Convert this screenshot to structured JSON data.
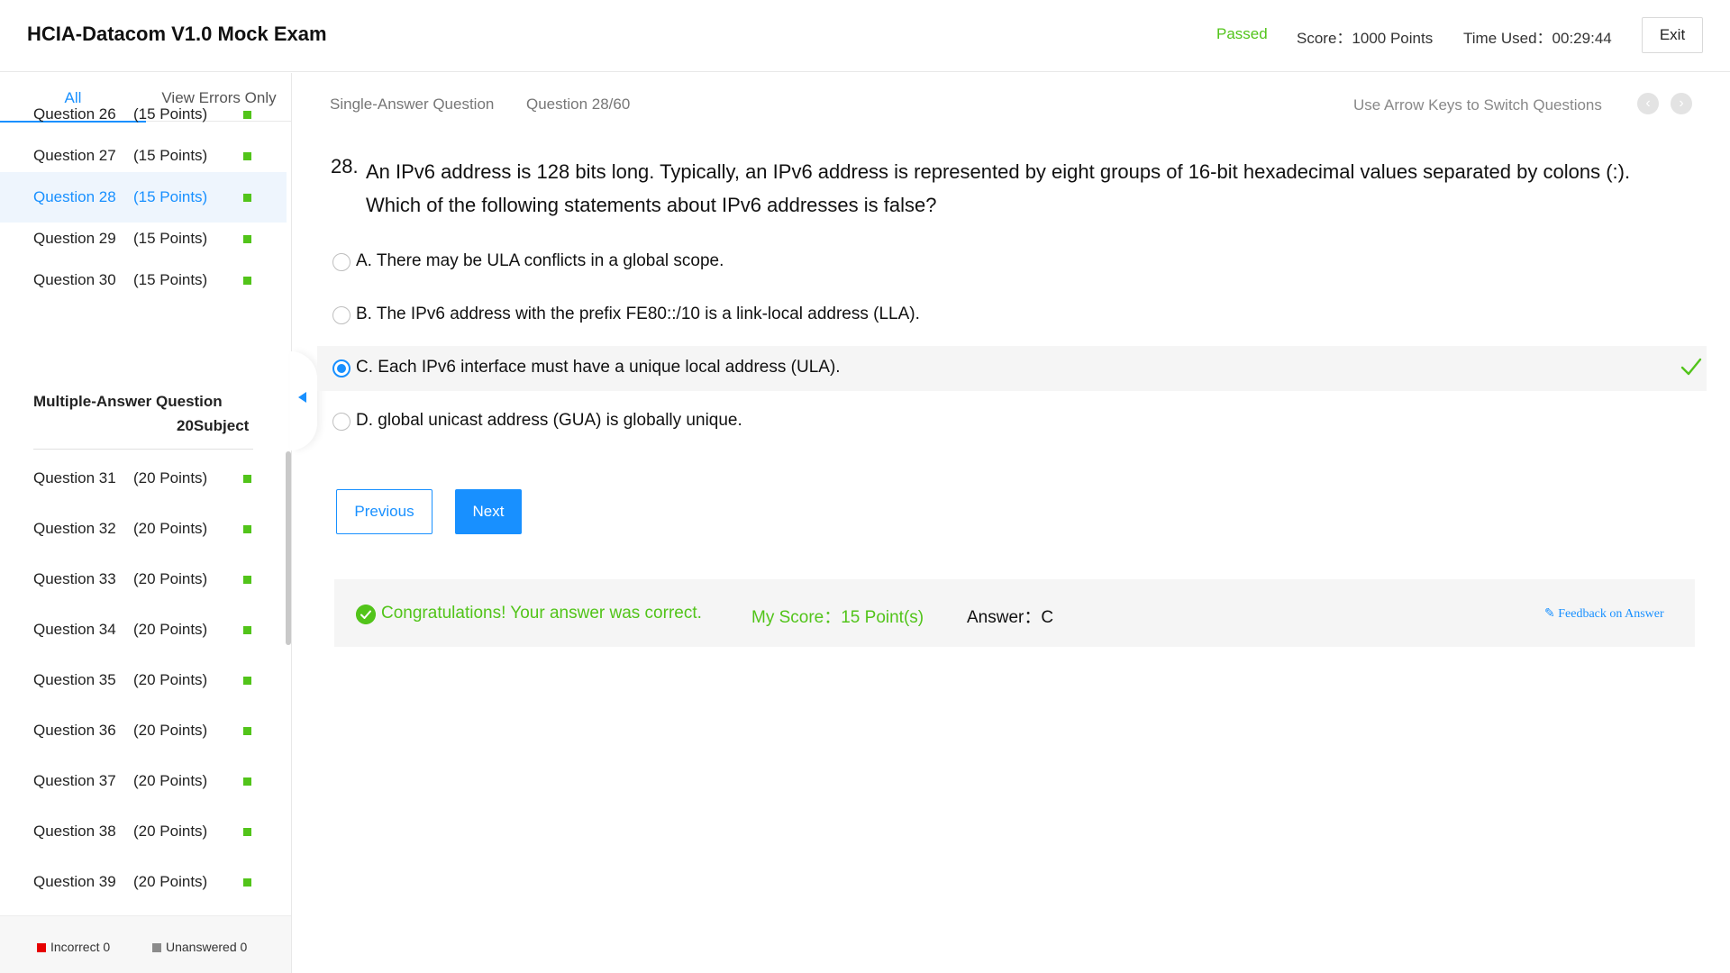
{
  "header": {
    "title": "HCIA-Datacom V1.0 Mock Exam",
    "status": "Passed",
    "score": "Score：1000 Points",
    "time_used": "Time Used：00:29:44",
    "exit_label": "Exit",
    "status_color": "#52c41a"
  },
  "sidebar": {
    "tabs": [
      "All",
      "View Errors Only"
    ],
    "active_tab": "All",
    "single_items": [
      {
        "name": "Question 26",
        "points": "(15 Points)"
      },
      {
        "name": "Question 27",
        "points": "(15 Points)"
      },
      {
        "name": "Question 28",
        "points": "(15 Points)"
      },
      {
        "name": "Question 29",
        "points": "(15 Points)"
      },
      {
        "name": "Question 30",
        "points": "(15 Points)"
      }
    ],
    "active_item": "Question 28",
    "section": {
      "title": "Multiple-Answer Question",
      "subtitle": "20Subject"
    },
    "multi_items": [
      {
        "name": "Question 31",
        "points": "(20 Points)"
      },
      {
        "name": "Question 32",
        "points": "(20 Points)"
      },
      {
        "name": "Question 33",
        "points": "(20 Points)"
      },
      {
        "name": "Question 34",
        "points": "(20 Points)"
      },
      {
        "name": "Question 35",
        "points": "(20 Points)"
      },
      {
        "name": "Question 36",
        "points": "(20 Points)"
      },
      {
        "name": "Question 37",
        "points": "(20 Points)"
      },
      {
        "name": "Question 38",
        "points": "(20 Points)"
      },
      {
        "name": "Question 39",
        "points": "(20 Points)"
      }
    ],
    "legend": {
      "incorrect": "Incorrect 0",
      "unanswered": "Unanswered 0",
      "incorrect_color": "#e60000",
      "unanswered_color": "#8c8c8c",
      "correct_color": "#52c41a"
    }
  },
  "main": {
    "question_type": "Single-Answer Question",
    "progress": "Question 28/60",
    "nav_hint": "Use Arrow Keys to Switch Questions",
    "number": "28.",
    "text": "An IPv6 address is 128 bits long. Typically, an IPv6 address is represented by eight groups of 16-bit hexadecimal values separated by colons (:). Which of the following statements about IPv6 addresses is false?",
    "options": [
      {
        "label": "A. There may be ULA conflicts in a global scope.",
        "selected": false
      },
      {
        "label": "B. The IPv6 address with the prefix FE80::/10 is a link-local address (LLA).",
        "selected": false
      },
      {
        "label": "C. Each IPv6 interface must have a unique local address (ULA).",
        "selected": true,
        "correct": true
      },
      {
        "label": "D. global unicast address (GUA) is globally unique.",
        "selected": false
      }
    ],
    "previous_label": "Previous",
    "next_label": "Next",
    "result": {
      "message": "Congratulations! Your answer was correct.",
      "my_score": "My Score：15 Point(s)",
      "answer": "Answer：C",
      "feedback": "Feedback on Answer"
    },
    "accent_color": "#1890ff",
    "icons": [
      "check-icon",
      "chevron-left-icon",
      "chevron-right-icon",
      "feedback-edit-icon",
      "collapse-arrow-icon"
    ]
  }
}
